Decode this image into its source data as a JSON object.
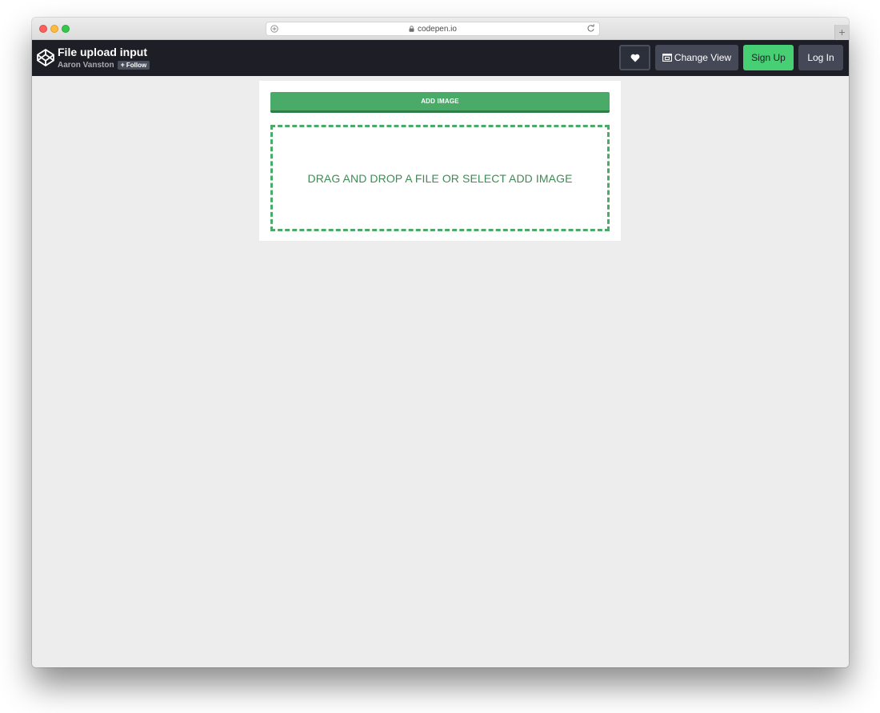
{
  "browser": {
    "url": "codepen.io",
    "new_tab_label": "+"
  },
  "header": {
    "pen_title": "File upload input",
    "author": "Aaron Vanston",
    "follow_label": "Follow",
    "follow_plus": "+",
    "change_view_label": "Change View",
    "sign_up_label": "Sign Up",
    "log_in_label": "Log In"
  },
  "uploader": {
    "add_button_label": "ADD IMAGE",
    "drop_zone_text": "DRAG AND DROP A FILE OR SELECT ADD IMAGE"
  },
  "colors": {
    "header_bg": "#1e1f26",
    "button_gray": "#444857",
    "signup_green": "#47cf73",
    "upload_green": "#4aab68",
    "drop_text_green": "#3d8c55",
    "page_bg": "#ededed"
  },
  "icons": {
    "logo": "codepen-logo-icon",
    "heart": "heart-icon",
    "change_view": "change-view-icon",
    "lock": "lock-icon",
    "reload": "reload-icon",
    "shield": "shield-icon"
  }
}
